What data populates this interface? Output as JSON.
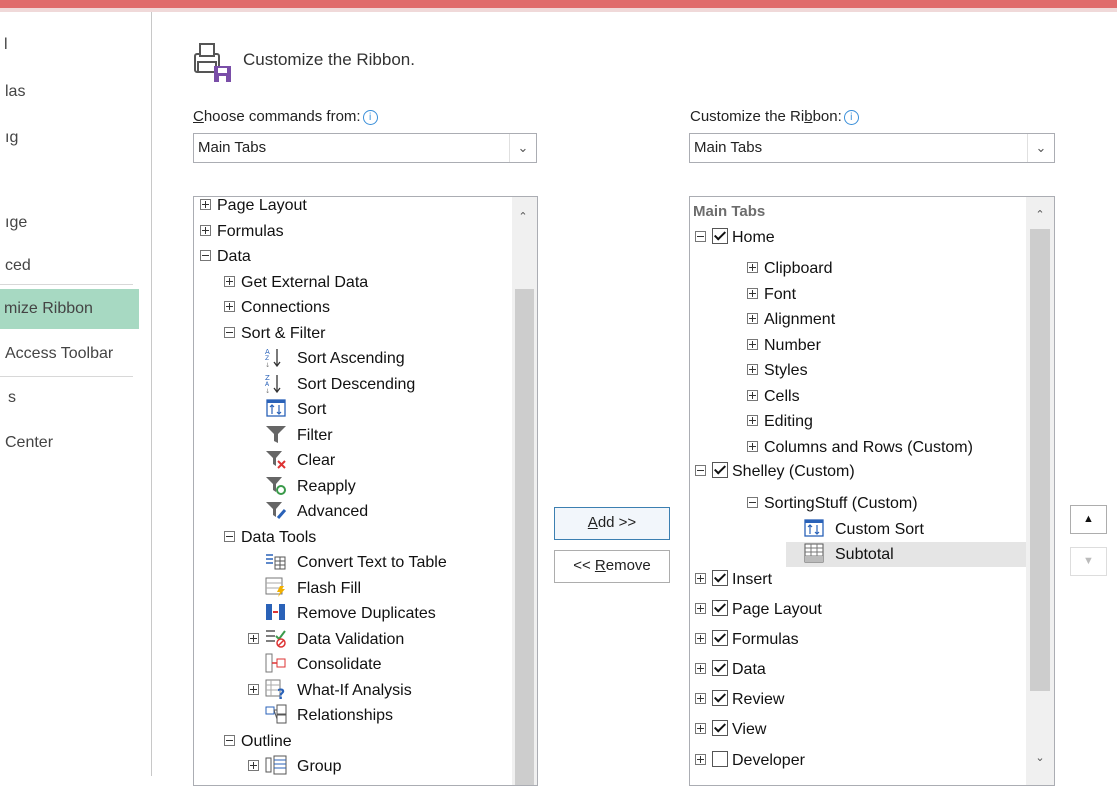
{
  "nav": {
    "items": [
      "l",
      "las",
      "ıg",
      "ıge",
      "ced",
      "mize Ribbon",
      "Access Toolbar",
      "s",
      "Center"
    ],
    "selected_index": 5
  },
  "header": {
    "title": "Customize the Ribbon."
  },
  "left": {
    "label_u": "C",
    "label_rest": "hoose commands from:",
    "combo_value": "Main Tabs",
    "items": [
      {
        "label": "Page Layout",
        "toggle": "plus",
        "indent": 0,
        "icon": ""
      },
      {
        "label": "Formulas",
        "toggle": "plus",
        "indent": 0,
        "icon": ""
      },
      {
        "label": "Data",
        "toggle": "minus",
        "indent": 0,
        "icon": ""
      },
      {
        "label": "Get External Data",
        "toggle": "plus",
        "indent": 1,
        "icon": ""
      },
      {
        "label": "Connections",
        "toggle": "plus",
        "indent": 1,
        "icon": ""
      },
      {
        "label": "Sort & Filter",
        "toggle": "minus",
        "indent": 1,
        "icon": ""
      },
      {
        "label": "Sort Ascending",
        "toggle": "",
        "indent": 2,
        "icon": "sort-ascending-icon"
      },
      {
        "label": "Sort Descending",
        "toggle": "",
        "indent": 2,
        "icon": "sort-descending-icon"
      },
      {
        "label": "Sort",
        "toggle": "",
        "indent": 2,
        "icon": "sort-icon"
      },
      {
        "label": "Filter",
        "toggle": "",
        "indent": 2,
        "icon": "filter-icon"
      },
      {
        "label": "Clear",
        "toggle": "",
        "indent": 2,
        "icon": "clear-filter-icon"
      },
      {
        "label": "Reapply",
        "toggle": "",
        "indent": 2,
        "icon": "reapply-icon"
      },
      {
        "label": "Advanced",
        "toggle": "",
        "indent": 2,
        "icon": "advanced-filter-icon"
      },
      {
        "label": "Data Tools",
        "toggle": "minus",
        "indent": 1,
        "icon": ""
      },
      {
        "label": "Convert Text to Table",
        "toggle": "",
        "indent": 2,
        "icon": "text-to-table-icon"
      },
      {
        "label": "Flash Fill",
        "toggle": "",
        "indent": 2,
        "icon": "flash-fill-icon"
      },
      {
        "label": "Remove Duplicates",
        "toggle": "",
        "indent": 2,
        "icon": "remove-duplicates-icon"
      },
      {
        "label": "Data Validation",
        "toggle": "plus",
        "indent": 2,
        "icon": "data-validation-icon"
      },
      {
        "label": "Consolidate",
        "toggle": "",
        "indent": 2,
        "icon": "consolidate-icon"
      },
      {
        "label": "What-If Analysis",
        "toggle": "plus",
        "indent": 2,
        "icon": "what-if-icon"
      },
      {
        "label": "Relationships",
        "toggle": "",
        "indent": 2,
        "icon": "relationships-icon"
      },
      {
        "label": "Outline",
        "toggle": "minus",
        "indent": 1,
        "icon": ""
      },
      {
        "label": "Group",
        "toggle": "plus",
        "indent": 2,
        "icon": "group-icon"
      }
    ]
  },
  "buttons": {
    "add_u": "A",
    "add_rest": "dd >>",
    "remove_pre": "<< ",
    "remove_u": "R",
    "remove_rest": "emove"
  },
  "right": {
    "label_pre": "Customize the Ri",
    "label_u": "b",
    "label_rest": "bon:",
    "combo_value": "Main Tabs",
    "header": "Main Tabs",
    "items": [
      {
        "label": "Home",
        "toggle": "minus",
        "checked": true,
        "indent": 0,
        "icon": ""
      },
      {
        "label": "Clipboard",
        "toggle": "plus",
        "checked": null,
        "indent": 1,
        "icon": ""
      },
      {
        "label": "Font",
        "toggle": "plus",
        "checked": null,
        "indent": 1,
        "icon": ""
      },
      {
        "label": "Alignment",
        "toggle": "plus",
        "checked": null,
        "indent": 1,
        "icon": ""
      },
      {
        "label": "Number",
        "toggle": "plus",
        "checked": null,
        "indent": 1,
        "icon": ""
      },
      {
        "label": "Styles",
        "toggle": "plus",
        "checked": null,
        "indent": 1,
        "icon": ""
      },
      {
        "label": "Cells",
        "toggle": "plus",
        "checked": null,
        "indent": 1,
        "icon": ""
      },
      {
        "label": "Editing",
        "toggle": "plus",
        "checked": null,
        "indent": 1,
        "icon": ""
      },
      {
        "label": "Columns and Rows (Custom)",
        "toggle": "plus",
        "checked": null,
        "indent": 1,
        "icon": ""
      },
      {
        "label": "Shelley (Custom)",
        "toggle": "minus",
        "checked": true,
        "indent": 0,
        "icon": ""
      },
      {
        "label": "SortingStuff (Custom)",
        "toggle": "minus",
        "checked": null,
        "indent": 1,
        "icon": ""
      },
      {
        "label": "Custom Sort",
        "toggle": "",
        "checked": null,
        "indent": 2,
        "icon": "sort-icon"
      },
      {
        "label": "Subtotal",
        "toggle": "",
        "checked": null,
        "indent": 2,
        "icon": "subtotal-icon",
        "selected": true
      },
      {
        "label": "Insert",
        "toggle": "plus",
        "checked": true,
        "indent": 0,
        "icon": ""
      },
      {
        "label": "Page Layout",
        "toggle": "plus",
        "checked": true,
        "indent": 0,
        "icon": ""
      },
      {
        "label": "Formulas",
        "toggle": "plus",
        "checked": true,
        "indent": 0,
        "icon": ""
      },
      {
        "label": "Data",
        "toggle": "plus",
        "checked": true,
        "indent": 0,
        "icon": ""
      },
      {
        "label": "Review",
        "toggle": "plus",
        "checked": true,
        "indent": 0,
        "icon": ""
      },
      {
        "label": "View",
        "toggle": "plus",
        "checked": true,
        "indent": 0,
        "icon": ""
      },
      {
        "label": "Developer",
        "toggle": "plus",
        "checked": false,
        "indent": 0,
        "icon": ""
      }
    ]
  },
  "colors": {
    "accent_nav": "#a7d9c2",
    "top_bar": "#e06c6c",
    "info": "#3a8fd9"
  }
}
